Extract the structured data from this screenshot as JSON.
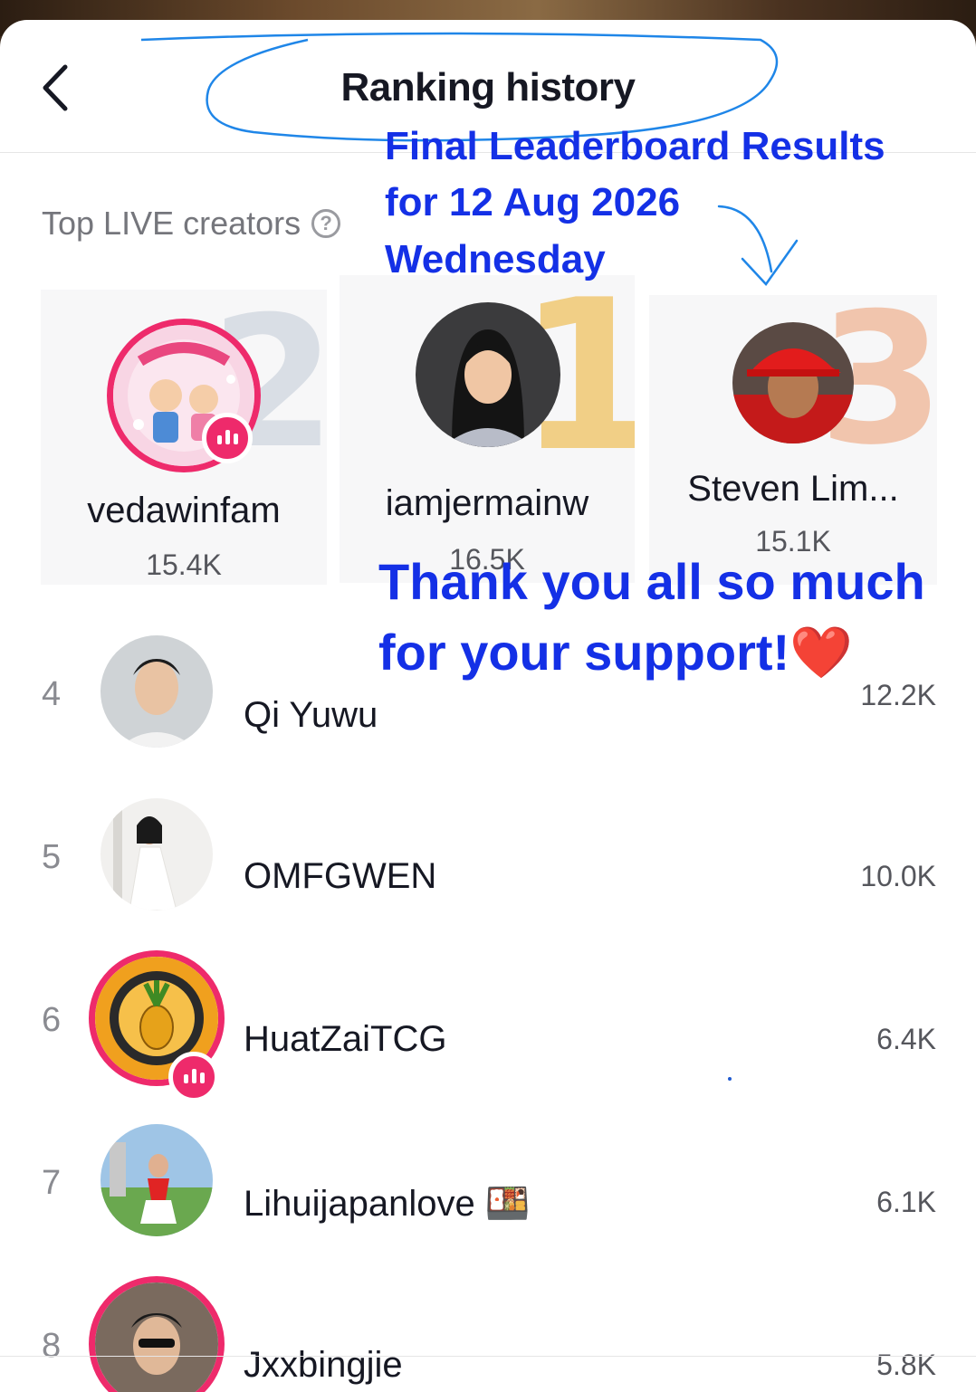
{
  "header": {
    "title": "Ranking history"
  },
  "section": {
    "label": "Top LIVE creators"
  },
  "podium": [
    {
      "rank": "2",
      "name": "vedawinfam",
      "score": "15.4K",
      "live": true
    },
    {
      "rank": "1",
      "name": "iamjermainw",
      "score": "16.5K",
      "live": false
    },
    {
      "rank": "3",
      "name": "Steven Lim...",
      "score": "15.1K",
      "live": false
    }
  ],
  "list": [
    {
      "rank": "4",
      "name": "Qi Yuwu",
      "score": "12.2K",
      "live": false
    },
    {
      "rank": "5",
      "name": "OMFGWEN",
      "score": "10.0K",
      "live": false
    },
    {
      "rank": "6",
      "name": "HuatZaiTCG",
      "score": "6.4K",
      "live": true
    },
    {
      "rank": "7",
      "name": "Lihuijapanlove 🍱",
      "score": "6.1K",
      "live": false
    },
    {
      "rank": "8",
      "name": "Jxxbingjie",
      "score": "5.8K",
      "live": true
    }
  ],
  "annotations": {
    "line1": "Final Leaderboard Results",
    "line2": "for 12 Aug 2026",
    "line3": "Wednesday",
    "thanks1": "Thank you all so much",
    "thanks2": "for your support!❤️"
  },
  "colors": {
    "annotation": "#1430e6",
    "live_ring": "#ee2a6b",
    "gold": "#f1cf86",
    "silver": "#d9dee5",
    "bronze": "#f1c5ad"
  }
}
